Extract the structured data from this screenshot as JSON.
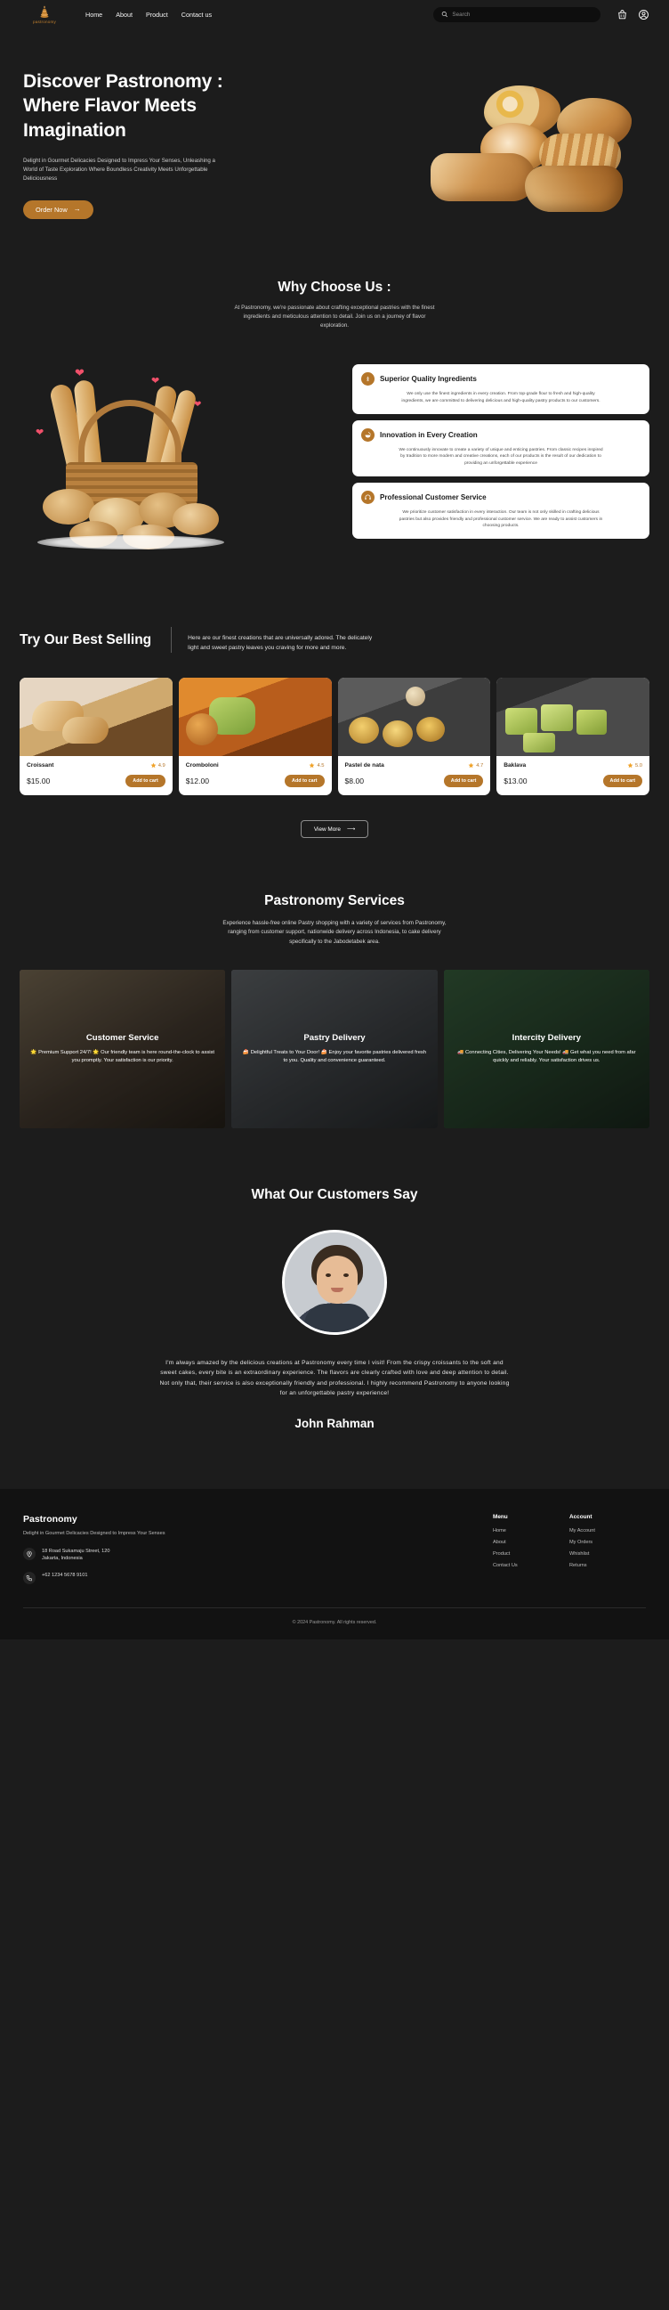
{
  "nav": {
    "brand": "pastronomy",
    "links": [
      {
        "label": "Home"
      },
      {
        "label": "About"
      },
      {
        "label": "Product"
      },
      {
        "label": "Contact us"
      }
    ],
    "search": {
      "placeholder": "Search",
      "value": ""
    },
    "icons": {
      "cart": "shopping-bag-icon",
      "account": "user-account-icon",
      "search": "search-icon"
    }
  },
  "hero": {
    "title": "Discover Pastronomy : Where Flavor Meets Imagination",
    "subtitle": "Delight in Gourmet Delicacies Designed to Impress Your Senses, Unleashing a World of Taste Exploration Where Boundless Creativity Meets Unforgettable Deliciousness",
    "cta": "Order Now",
    "cta_arrow": "→"
  },
  "why": {
    "title": "Why Choose Us :",
    "subtitle": "At Pastronomy, we're passionate about crafting exceptional pastries with the finest ingredients and meticulous attention to detail. Join us on a journey of flavor exploration.",
    "cards": [
      {
        "icon": "wheat-grain-icon",
        "title": "Superior Quality Ingredients",
        "body": "We only use the finest ingredients in every creation. From top-grade flour to fresh and high-quality ingredients, we are committed to delivering delicious and high-quality pastry products to our customers."
      },
      {
        "icon": "mixing-bowl-icon",
        "title": "Innovation in Every Creation",
        "body": "We continuously innovate to create a variety of unique and enticing pastries. From classic recipes inspired by tradition to more modern and creative creations, each of our products is the result of our dedication to providing an unforgettable experience"
      },
      {
        "icon": "headset-support-icon",
        "title": "Professional Customer Service",
        "body": "We prioritize customer satisfaction in every interaction. Our team is not only skilled in crafting delicious pastries but also provides friendly and professional customer service. We are ready to assist customers in choosing products."
      }
    ]
  },
  "best": {
    "title": "Try Our Best Selling",
    "description": "Here are our finest creations that are universally adored. The delicately light and sweet pastry leaves you craving for more and more.",
    "add_to_cart_label": "Add to cart",
    "view_more": "View More",
    "view_more_arrow": "⟶",
    "products": [
      {
        "name": "Croissant",
        "price": "$15.00",
        "rating": "4.9",
        "image": "croissant-photo"
      },
      {
        "name": "Cromboloni",
        "price": "$12.00",
        "rating": "4.5",
        "image": "cromboloni-photo"
      },
      {
        "name": "Pastel de nata",
        "price": "$8.00",
        "rating": "4.7",
        "image": "pastel-de-nata-photo"
      },
      {
        "name": "Baklava",
        "price": "$13.00",
        "rating": "5.0",
        "image": "baklava-photo"
      }
    ]
  },
  "services": {
    "title": "Pastronomy Services",
    "subtitle": "Experience hassle-free online Pastry shopping with a variety of services from Pastronomy, ranging from customer support, nationwide delivery across Indonesia, to cake delivery specifically to the Jabodetabek area.",
    "items": [
      {
        "title": "Customer Service",
        "body": "🌟 Premium Support 24/7! 🌟 Our friendly team is here round-the-clock to assist you promptly. Your satisfaction is our priority."
      },
      {
        "title": "Pastry Delivery",
        "body": "🍰 Delightful Treats to Your Door! 🍰 Enjoy your favorite pastries delivered fresh to you. Quality and convenience guaranteed."
      },
      {
        "title": "Intercity Delivery",
        "body": "🚚 Connecting Cities, Delivering Your Needs! 🚚 Get what you need from afar quickly and reliably. Your satisfaction drives us."
      }
    ]
  },
  "testimonial": {
    "title": "What Our Customers Say",
    "quote": "I'm always amazed by the delicious creations at Pastronomy every time I visit! From the crispy croissants to the soft and sweet cakes, every bite is an extraordinary experience. The flavors are clearly crafted with love and deep attention to detail. Not only that, their service is also exceptionally friendly and professional. I highly recommend Pastronomy to anyone looking for an unforgettable pastry experience!",
    "name": "John Rahman",
    "avatar": "customer-portrait-photo"
  },
  "footer": {
    "brand": "Pastronomy",
    "tagline": "Delight in Gourmet Delicacies Designed to Impress Your Senses",
    "address_line1": "18 Road Sukamaju Street, 120",
    "address_line2": "Jakarta, Indonesia",
    "phone": "+62 1234 5678 9101",
    "menu": {
      "heading": "Menu",
      "links": [
        {
          "label": "Home"
        },
        {
          "label": "About"
        },
        {
          "label": "Product"
        },
        {
          "label": "Contact Us"
        }
      ]
    },
    "account": {
      "heading": "Account",
      "links": [
        {
          "label": "My Account"
        },
        {
          "label": "My Orders"
        },
        {
          "label": "Whishlist"
        },
        {
          "label": "Returns"
        }
      ]
    },
    "copyright": "© 2024 Pastronomy. All rights reserved."
  },
  "colors": {
    "background": "#1c1c1c",
    "footer_bg": "#121212",
    "accent": "#b5762a",
    "card_bg": "#ffffff",
    "text": "#ffffff"
  }
}
